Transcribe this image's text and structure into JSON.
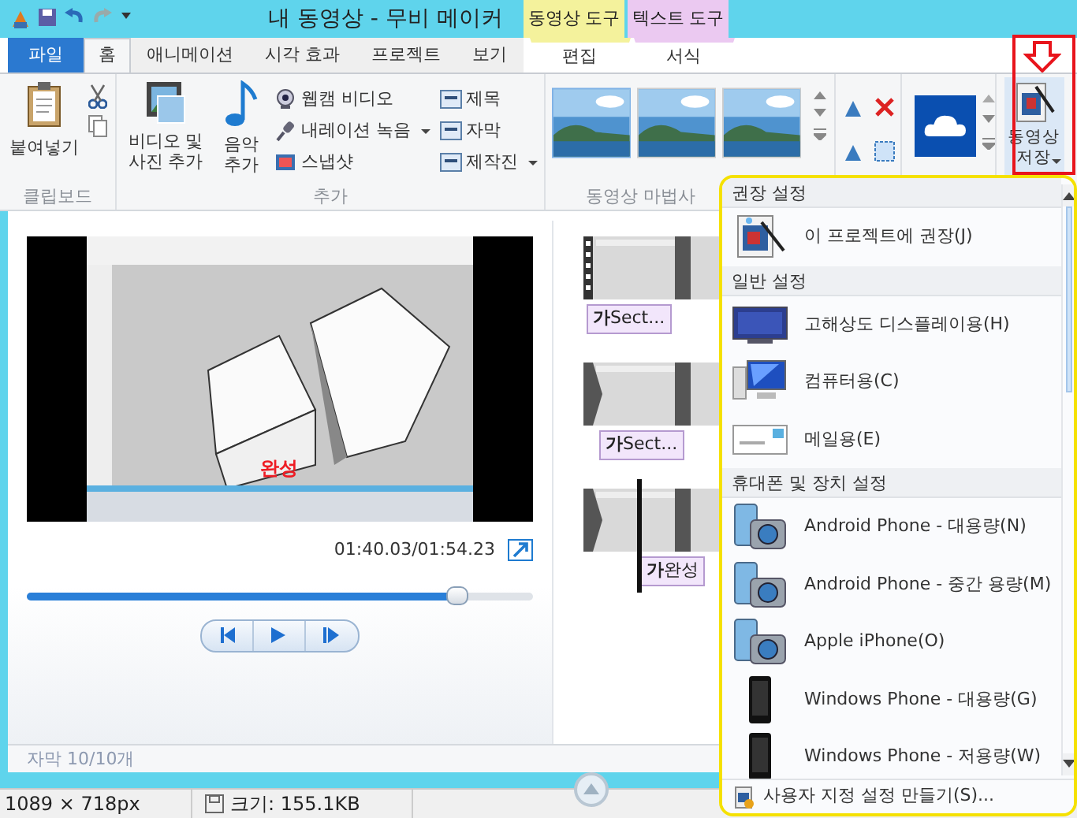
{
  "window": {
    "title": "내 동영상 - 무비 메이커"
  },
  "context_tabs": [
    {
      "label": "동영상 도구",
      "color": "#f4f29c"
    },
    {
      "label": "텍스트 도구",
      "color": "#ebc9f1"
    }
  ],
  "tabs": [
    {
      "label": "파일",
      "kind": "file",
      "selected": false
    },
    {
      "label": "홈",
      "kind": "tab",
      "selected": true
    },
    {
      "label": "애니메이션",
      "kind": "tab",
      "selected": false
    },
    {
      "label": "시각 효과",
      "kind": "tab",
      "selected": false
    },
    {
      "label": "프로젝트",
      "kind": "tab",
      "selected": false
    },
    {
      "label": "보기",
      "kind": "tab",
      "selected": false
    },
    {
      "label": "편집",
      "kind": "context",
      "selected": false
    },
    {
      "label": "서식",
      "kind": "context",
      "selected": false
    }
  ],
  "ribbon": {
    "clipboard": {
      "label": "클립보드",
      "paste": "붙여넣기"
    },
    "add": {
      "label": "추가",
      "add_media": "비디오 및 사진 추가",
      "music": "음악 추가",
      "small": [
        {
          "label": "웹캠 비디오",
          "kind": "webcam",
          "dropdown": false
        },
        {
          "label": "내레이션 녹음",
          "kind": "mic",
          "dropdown": true
        },
        {
          "label": "스냅샷",
          "kind": "snapshot",
          "dropdown": false
        }
      ],
      "text": [
        {
          "label": "제목",
          "dropdown": false
        },
        {
          "label": "자막",
          "dropdown": false
        },
        {
          "label": "제작진",
          "dropdown": true
        }
      ]
    },
    "themes": {
      "label": "동영상 마법사"
    },
    "save": {
      "label": "동영상 저장",
      "dropdown": true
    }
  },
  "preview": {
    "caption": "완성",
    "time": "01:40.03/01:54.23",
    "seek": {
      "level": 0.85
    }
  },
  "storyboard": [
    {
      "kind": "start",
      "caption": "**가**Sect...",
      "playhead": false
    },
    {
      "kind": "transition",
      "caption": "**가**Sect...",
      "playhead": false
    },
    {
      "kind": "transition",
      "caption": "**가**완성",
      "playhead": true
    }
  ],
  "status_text": "자막 10/10개",
  "footer": [
    "1089 × 718px",
    "크기: 155.1KB"
  ],
  "save_menu": {
    "sections": [
      {
        "header": "권장 설정",
        "items": [
          {
            "label": "이 프로젝트에 권장(J)",
            "kind": "project"
          }
        ]
      },
      {
        "header": "일반 설정",
        "items": [
          {
            "label": "고해상도 디스플레이용(H)",
            "kind": "display"
          },
          {
            "label": "컴퓨터용(C)",
            "kind": "computer"
          },
          {
            "label": "메일용(E)",
            "kind": "mail"
          }
        ]
      },
      {
        "header": "휴대폰 및 장치 설정",
        "items": [
          {
            "label": "Android Phone - 대용량(N)",
            "kind": "device"
          },
          {
            "label": "Android Phone - 중간 용량(M)",
            "kind": "device"
          },
          {
            "label": "Apple iPhone(O)",
            "kind": "device"
          },
          {
            "label": "Windows Phone - 대용량(G)",
            "kind": "phone"
          },
          {
            "label": "Windows Phone - 저용량(W)",
            "kind": "phone"
          }
        ]
      }
    ],
    "footer": "사용자 지정 설정 만들기(S)..."
  },
  "annotations": [
    {
      "kind": "menu-frame",
      "color": "#f5e100"
    },
    {
      "kind": "button-frame",
      "color": "#e8141c"
    },
    {
      "kind": "arrow",
      "color": "#e8141c"
    }
  ]
}
